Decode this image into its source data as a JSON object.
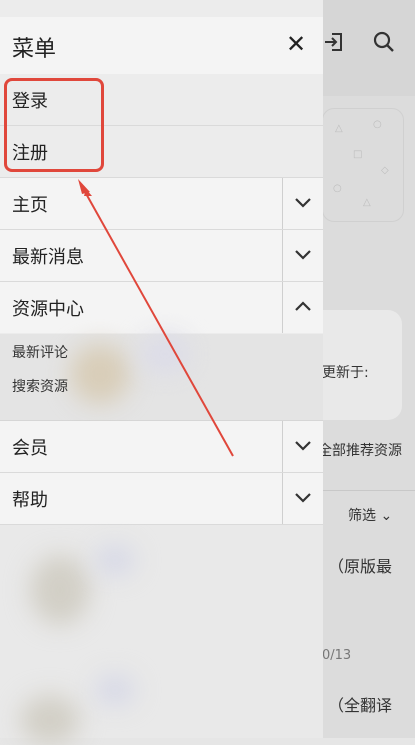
{
  "drawer": {
    "title": "菜单",
    "close_icon": "close-icon",
    "items": [
      {
        "label": "登录"
      },
      {
        "label": "注册"
      },
      {
        "label": "主页",
        "expandable": true,
        "expanded": false
      },
      {
        "label": "最新消息",
        "expandable": true,
        "expanded": false
      },
      {
        "label": "资源中心",
        "expandable": true,
        "expanded": true,
        "children": [
          {
            "label": "最新评论"
          },
          {
            "label": "搜索资源"
          }
        ]
      },
      {
        "label": "会员",
        "expandable": true,
        "expanded": false
      },
      {
        "label": "帮助",
        "expandable": true,
        "expanded": false
      }
    ]
  },
  "background": {
    "icons": [
      "login-icon",
      "search-icon"
    ],
    "updated_text": "更新于:",
    "recommend_text": "全部推荐资源",
    "filter_label": "筛选",
    "item1_title": "（原版最",
    "item1_date": "0/13",
    "item2_title": "（全翻译"
  },
  "annotation": {
    "color": "#e0473b"
  }
}
